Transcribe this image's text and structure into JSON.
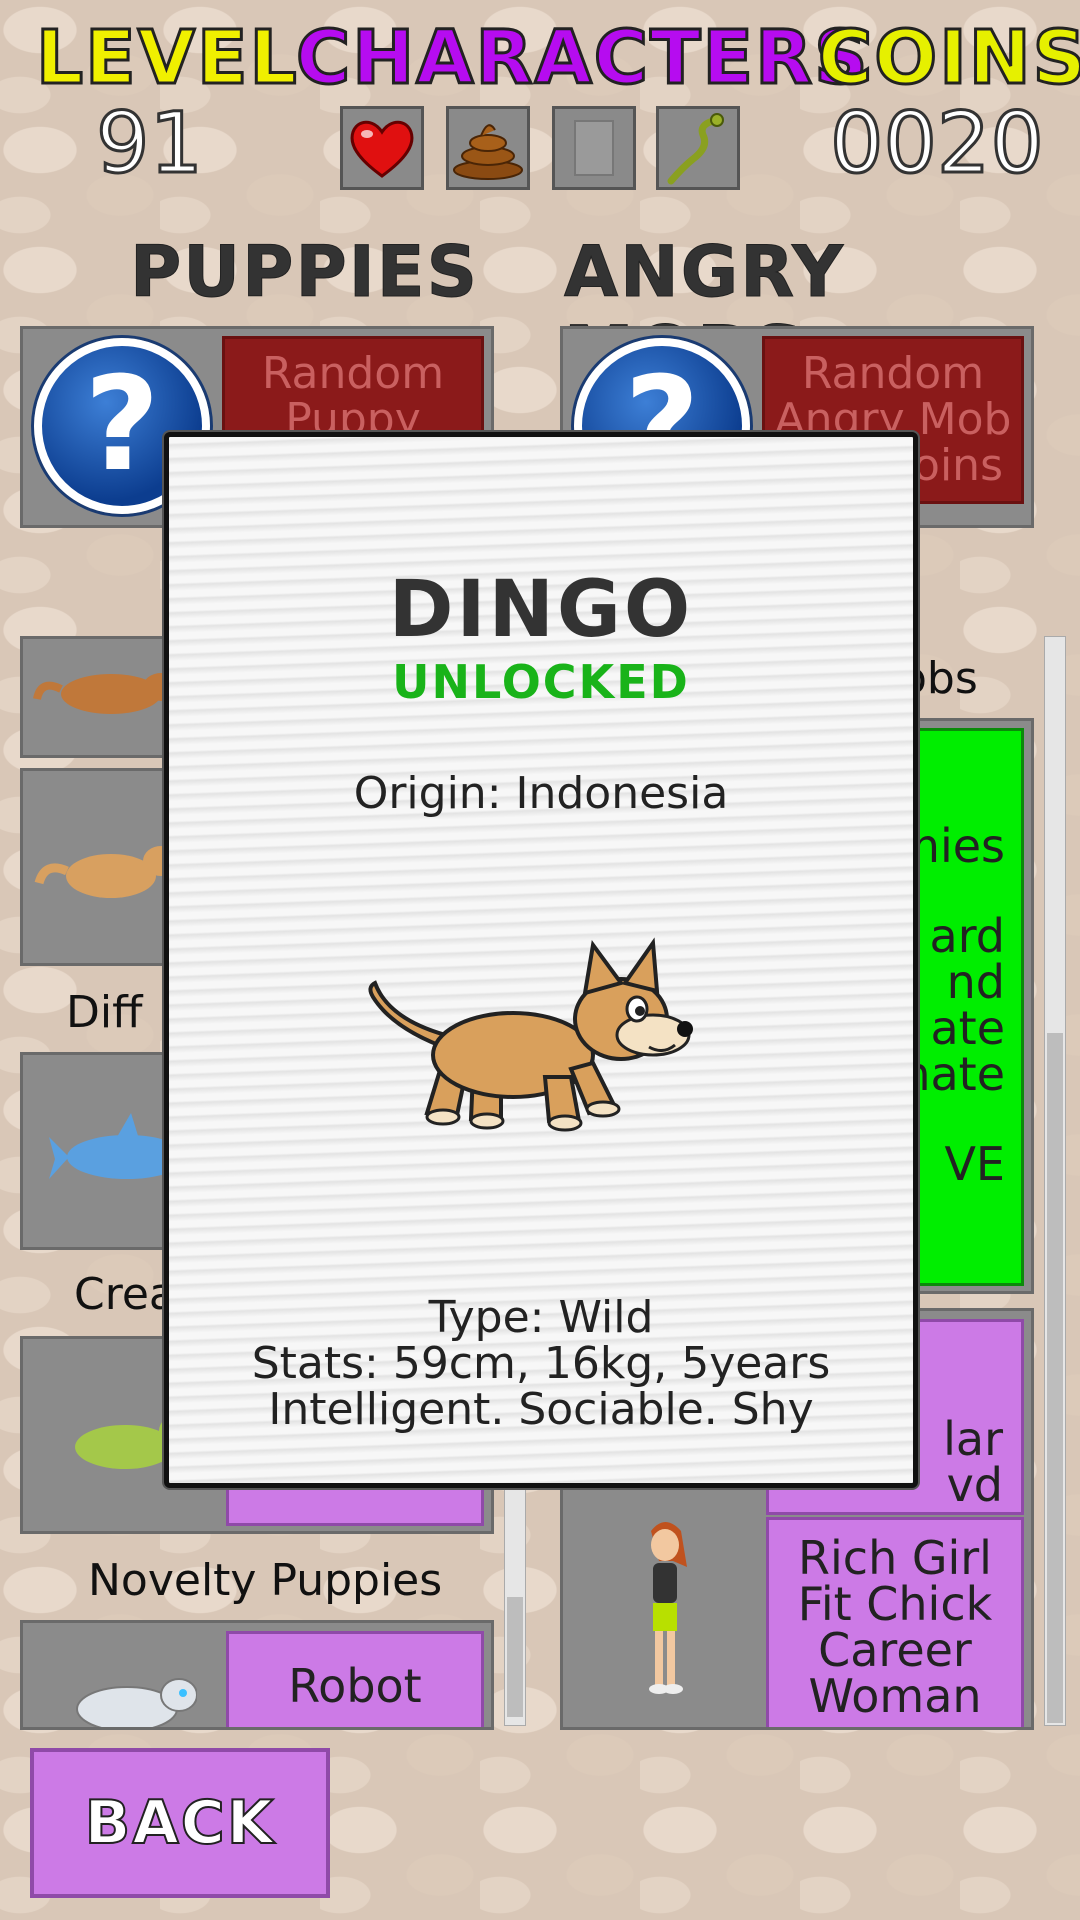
{
  "header": {
    "level_label": "LEVEL",
    "characters_label": "CHARACTERS",
    "coins_label": "COINS",
    "level_value": "91",
    "coins_value": "0020",
    "slots": [
      "heart-icon",
      "poop-icon",
      "empty-slot",
      "snake-icon"
    ]
  },
  "sections": {
    "puppies_title": "PUPPIES",
    "mobs_title": "ANGRY MOBS"
  },
  "puppies": {
    "random_label": "Random Puppy",
    "categories": [
      "Diff",
      "Crea",
      "Novelty Puppies"
    ],
    "robot_label": "Robot"
  },
  "mobs": {
    "random_label": "Random Angry Mob",
    "random_cost": "oins",
    "category_fragment": "obs",
    "green_lines": [
      "mies",
      "ard",
      "nd",
      "ate",
      "nate",
      "VE"
    ],
    "purple_top_lines": [
      "lar",
      "vd"
    ],
    "rich_girl_label": "Rich Girl Fit Chick Career Woman"
  },
  "modal": {
    "title": "DINGO",
    "status": "UNLOCKED",
    "origin": "Origin: Indonesia",
    "type": "Type: Wild",
    "stats": "Stats: 59cm, 16kg, 5years",
    "traits": "Intelligent. Sociable. Shy"
  },
  "back_label": "BACK",
  "colors": {
    "level": "#f0f000",
    "characters": "#b60cf0",
    "coins": "#e6f000",
    "unlocked": "#19b319",
    "purple": "#cc7ae6",
    "green": "#00ee00",
    "red": "#8b1a1a"
  }
}
